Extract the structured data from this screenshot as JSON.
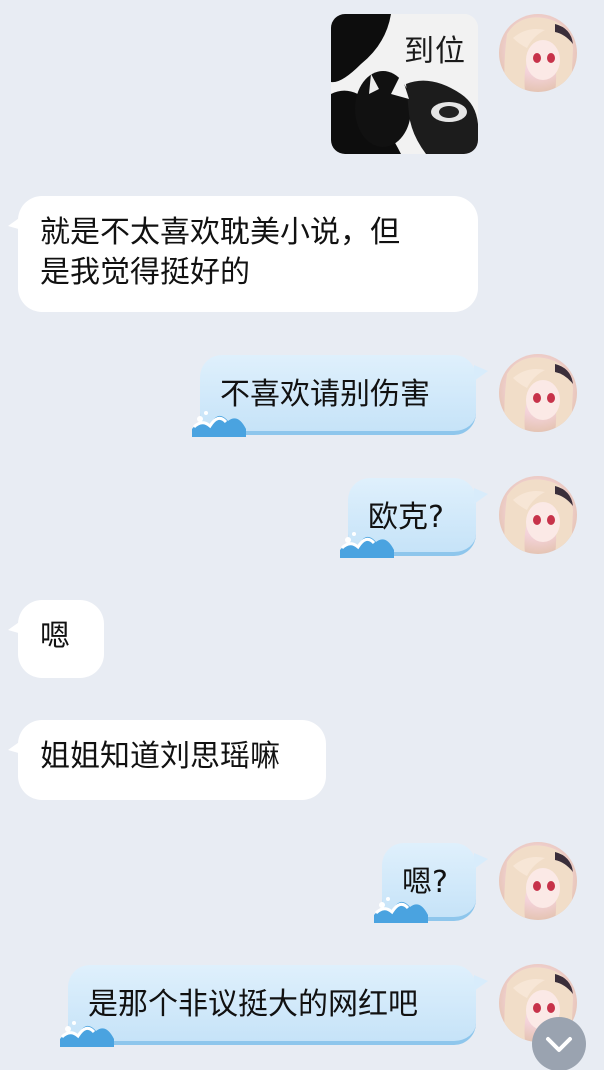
{
  "chat": {
    "sticker": {
      "caption": "到位"
    },
    "messages": [
      {
        "side": "in",
        "text_lines": [
          "就是不太喜欢耽美小说，但",
          "是我觉得挺好的"
        ]
      },
      {
        "side": "out",
        "text": "不喜欢请别伤害"
      },
      {
        "side": "out",
        "text": "欧克?"
      },
      {
        "side": "in",
        "text": "嗯"
      },
      {
        "side": "in",
        "text": "姐姐知道刘思瑶嘛"
      },
      {
        "side": "out",
        "text": "嗯?"
      },
      {
        "side": "out",
        "text": "是那个非议挺大的网红吧"
      }
    ]
  },
  "icons": {
    "avatar": "anime-girl-avatar-icon",
    "wave": "wave-decoration-icon",
    "scroll": "chevron-down-icon"
  },
  "colors": {
    "background": "#e8ecf3",
    "incoming_bubble": "#ffffff",
    "outgoing_bubble": "#d2e9fa",
    "scroll_button": "#9aa3b0"
  }
}
